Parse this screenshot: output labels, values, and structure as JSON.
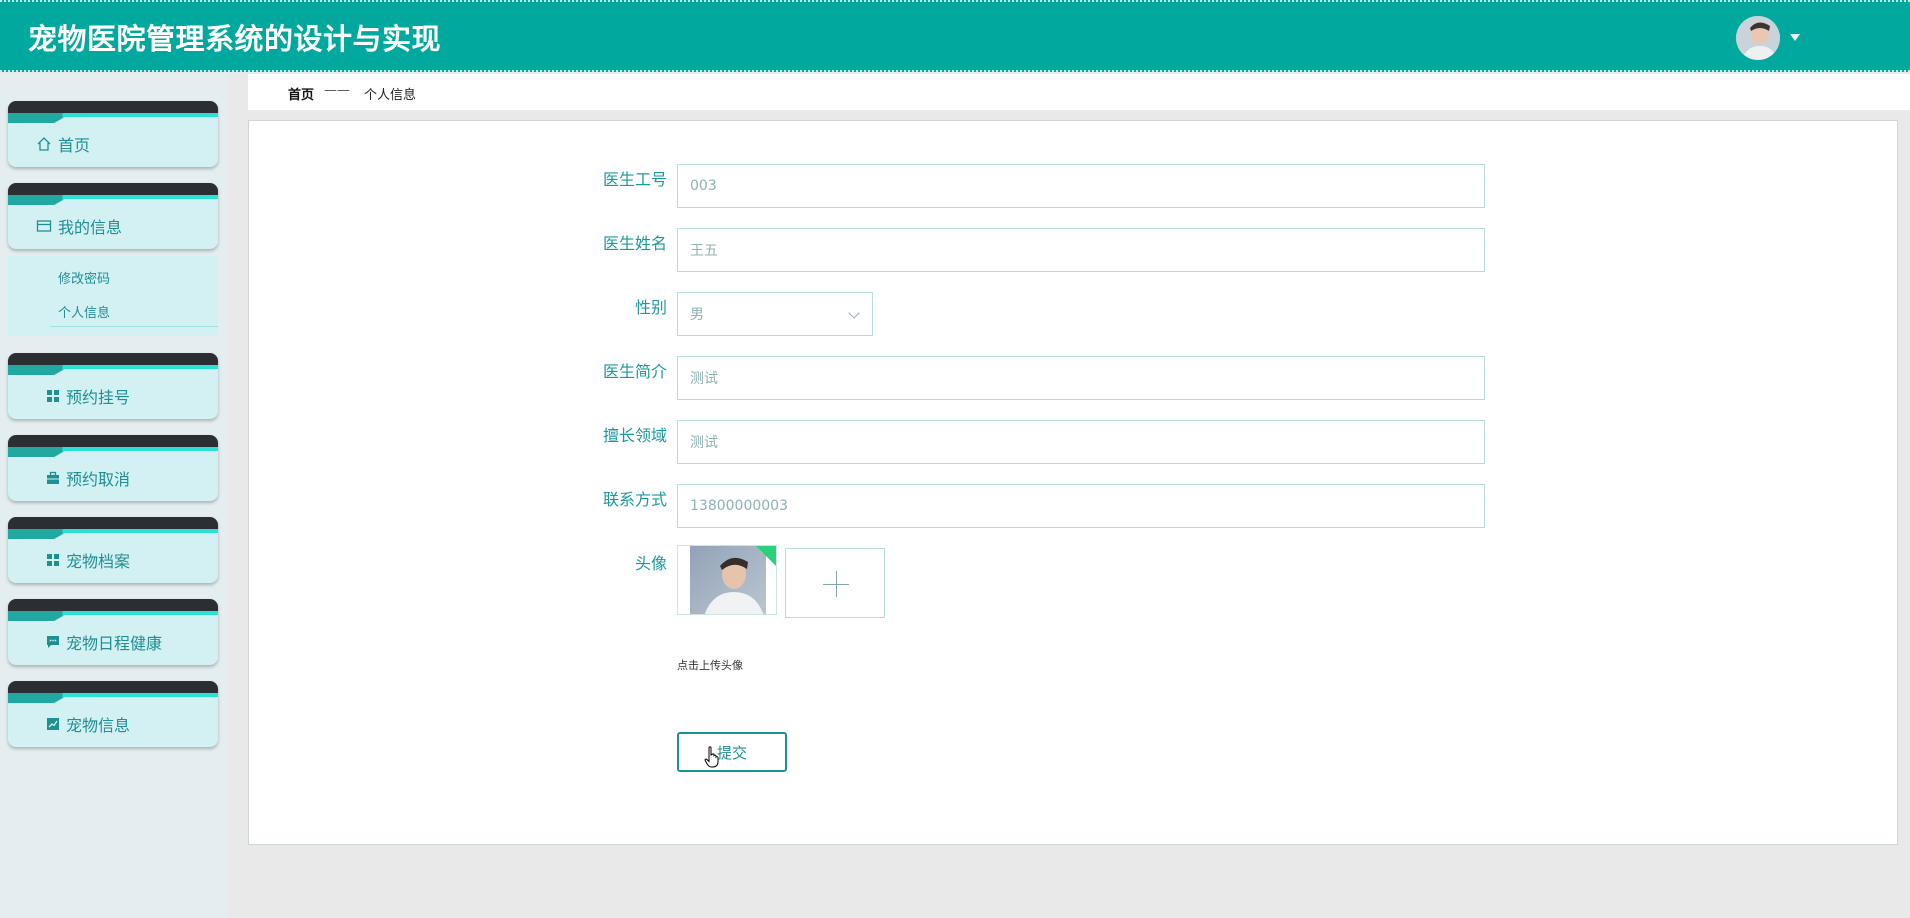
{
  "header": {
    "title": "宠物医院管理系统的设计与实现",
    "avatar_icon": "user-avatar"
  },
  "sidebar": {
    "items": [
      {
        "label": "首页",
        "icon": "home-icon"
      },
      {
        "label": "我的信息",
        "icon": "card-icon"
      },
      {
        "label": "预约挂号",
        "icon": "grid-icon"
      },
      {
        "label": "预约取消",
        "icon": "briefcase-icon"
      },
      {
        "label": "宠物档案",
        "icon": "grid-icon"
      },
      {
        "label": "宠物日程健康",
        "icon": "chat-icon"
      },
      {
        "label": "宠物信息",
        "icon": "chart-icon"
      }
    ],
    "submenu": [
      "修改密码",
      "个人信息"
    ]
  },
  "breadcrumb": {
    "home": "首页",
    "separator": "——",
    "current": "个人信息"
  },
  "form": {
    "doctor_id_label": "医生工号",
    "doctor_id_value": "003",
    "doctor_name_label": "医生姓名",
    "doctor_name_value": "王五",
    "gender_label": "性别",
    "gender_value": "男",
    "intro_label": "医生简介",
    "intro_value": "测试",
    "specialty_label": "擅长领域",
    "specialty_value": "测试",
    "contact_label": "联系方式",
    "contact_value": "13800000003",
    "avatar_label": "头像",
    "upload_tip": "点击上传头像",
    "submit_label": "提交"
  },
  "colors": {
    "brand": "#00a89d",
    "accent_text": "#1b9a9d",
    "sidebar_card": "#d3f0f3"
  }
}
